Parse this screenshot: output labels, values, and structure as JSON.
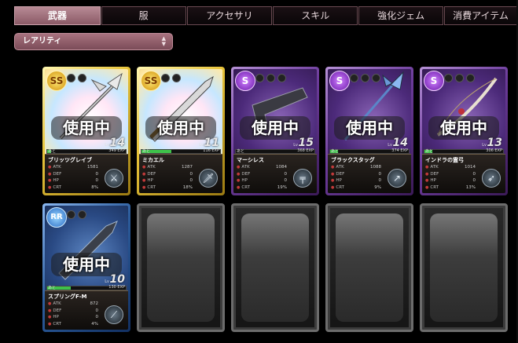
{
  "tabs": [
    {
      "label": "武器",
      "active": true
    },
    {
      "label": "服",
      "active": false
    },
    {
      "label": "アクセサリ",
      "active": false
    },
    {
      "label": "スキル",
      "active": false
    },
    {
      "label": "強化ジェム",
      "active": false
    },
    {
      "label": "消費アイテム",
      "active": false
    }
  ],
  "sort": {
    "label": "レアリティ"
  },
  "cards": [
    {
      "rank": "SS",
      "status": "使用中",
      "level": "14",
      "lv_label": "Lv",
      "exp_left": "あと",
      "exp": "349 EXP",
      "exp_fraction": 0.05,
      "name": "ブリッツグレイブ",
      "stats": [
        {
          "k": "ATK",
          "v": "1581"
        },
        {
          "k": "DEF",
          "v": "0"
        },
        {
          "k": "HP",
          "v": "0"
        },
        {
          "k": "CRT",
          "v": "8%"
        }
      ],
      "type_icon": "halberd-icon"
    },
    {
      "rank": "SS",
      "status": "使用中",
      "level": "11",
      "lv_label": "Lv",
      "exp_left": "あと",
      "exp": "116 EXP",
      "exp_fraction": 0.38,
      "name": "ミカエル",
      "stats": [
        {
          "k": "ATK",
          "v": "1287"
        },
        {
          "k": "DEF",
          "v": "0"
        },
        {
          "k": "HP",
          "v": "0"
        },
        {
          "k": "CRT",
          "v": "18%"
        }
      ],
      "type_icon": "sword-icon"
    },
    {
      "rank": "S",
      "status": "使用中",
      "level": "15",
      "lv_label": "Lv",
      "exp_left": "あと",
      "exp": "368 EXP",
      "exp_fraction": 0.0,
      "name": "マーシレス",
      "stats": [
        {
          "k": "ATK",
          "v": "1084"
        },
        {
          "k": "DEF",
          "v": "0"
        },
        {
          "k": "HP",
          "v": "0"
        },
        {
          "k": "CRT",
          "v": "19%"
        }
      ],
      "type_icon": "gun-icon"
    },
    {
      "rank": "S",
      "status": "使用中",
      "level": "14",
      "lv_label": "Lv",
      "exp_left": "あと",
      "exp": "374 EXP",
      "exp_fraction": 0.1,
      "name": "ブラックスタッグ",
      "stats": [
        {
          "k": "ATK",
          "v": "1088"
        },
        {
          "k": "DEF",
          "v": "0"
        },
        {
          "k": "HP",
          "v": "0"
        },
        {
          "k": "CRT",
          "v": "9%"
        }
      ],
      "type_icon": "spear-icon"
    },
    {
      "rank": "S",
      "status": "使用中",
      "level": "13",
      "lv_label": "Lv",
      "exp_left": "あと",
      "exp": "306 EXP",
      "exp_fraction": 0.1,
      "name": "インドラの霊弓",
      "stats": [
        {
          "k": "ATK",
          "v": "1014"
        },
        {
          "k": "DEF",
          "v": "0"
        },
        {
          "k": "HP",
          "v": "0"
        },
        {
          "k": "CRT",
          "v": "13%"
        }
      ],
      "type_icon": "bow-icon"
    },
    {
      "rank": "RR",
      "status": "使用中",
      "level": "10",
      "lv_label": "Lv",
      "exp_left": "あと",
      "exp": "130 EXP",
      "exp_fraction": 0.3,
      "name": "スプリングF-M",
      "stats": [
        {
          "k": "ATK",
          "v": "872"
        },
        {
          "k": "DEF",
          "v": "0"
        },
        {
          "k": "HP",
          "v": "0"
        },
        {
          "k": "CRT",
          "v": "4%"
        }
      ],
      "type_icon": "blade-icon"
    }
  ],
  "colors": {
    "accent": "#a7727f",
    "ss": "#e8c43a",
    "s": "#6d3c9c",
    "rr": "#2d5e9e"
  }
}
